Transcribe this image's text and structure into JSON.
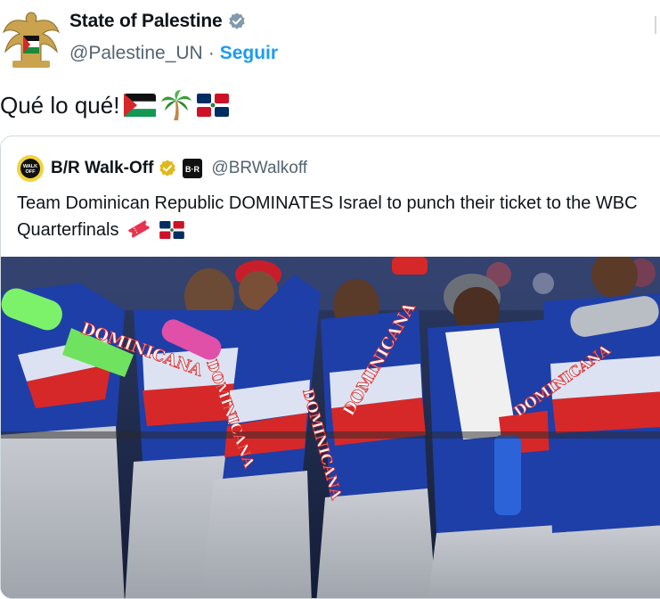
{
  "header": {
    "display_name": "State of Palestine",
    "handle": "@Palestine_UN",
    "separator": "·",
    "follow_label": "Seguir"
  },
  "tweet": {
    "text": "Qué lo qué!",
    "emojis": [
      "palestine-flag-icon",
      "palm-tree-icon",
      "dominican-flag-icon"
    ]
  },
  "quote": {
    "display_name": "B/R Walk-Off",
    "handle": "@BRWalkoff",
    "affiliate_badge": "B·R",
    "avatar_text": "WALK OFF",
    "text": "Team Dominican Republic DOMINATES Israel to punch their ticket to the WBC Quarterfinals",
    "emojis": [
      "ticket-icon",
      "dominican-flag-icon"
    ]
  },
  "media": {
    "jersey_texts": [
      "DOMINICANA",
      "DOMINICANA",
      "DOMINICANA",
      "DOMINICANA",
      "DOMINICANA"
    ]
  },
  "colors": {
    "link": "#1d9bf0",
    "secondary": "#536471",
    "jersey_blue": "#1e3fa8",
    "jersey_red": "#d62828",
    "pants_gray": "#b9bdc4"
  }
}
